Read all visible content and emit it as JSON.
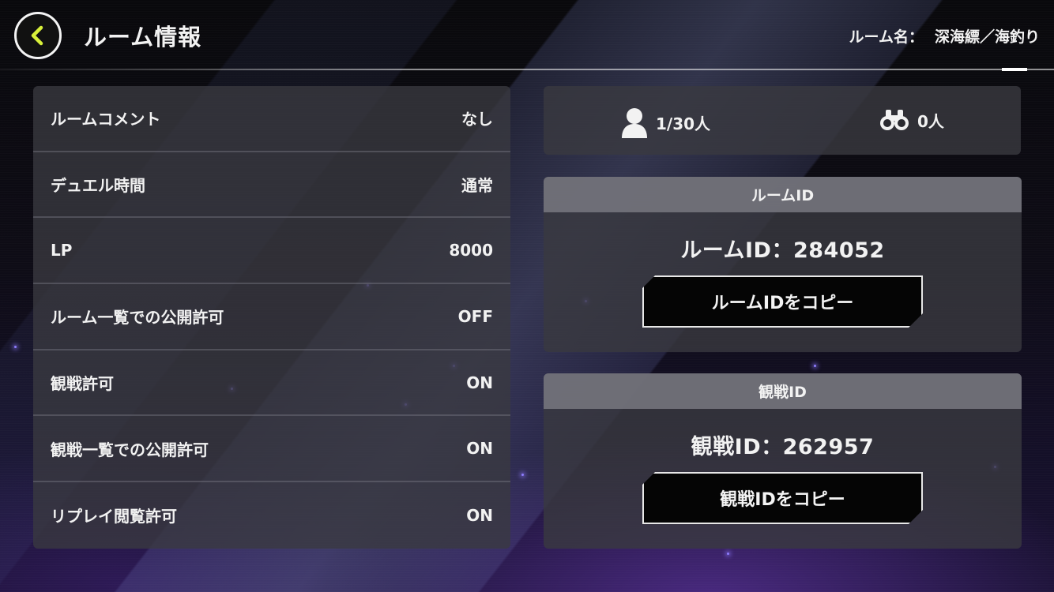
{
  "header": {
    "title": "ルーム情報",
    "room_name_label": "ルーム名：",
    "room_name_value": "深海縹／海釣り"
  },
  "settings": [
    {
      "label": "ルームコメント",
      "value": "なし"
    },
    {
      "label": "デュエル時間",
      "value": "通常"
    },
    {
      "label": "LP",
      "value": "8000"
    },
    {
      "label": "ルーム一覧での公開許可",
      "value": "OFF"
    },
    {
      "label": "観戦許可",
      "value": "ON"
    },
    {
      "label": "観戦一覧での公開許可",
      "value": "ON"
    },
    {
      "label": "リプレイ閲覧許可",
      "value": "ON"
    }
  ],
  "counts": {
    "players": "1/30人",
    "spectators": "0人"
  },
  "room_id_card": {
    "header": "ルームID",
    "id_text": "ルームID：284052",
    "copy_label": "ルームIDをコピー"
  },
  "watch_id_card": {
    "header": "観戦ID",
    "id_text": "観戦ID：262957",
    "copy_label": "観戦IDをコピー"
  },
  "colors": {
    "accent_back_arrow": "#d8f03a",
    "panel_bg": "#3a3a40",
    "card_header_bg": "#78787f"
  },
  "icons": {
    "back": "chevron-left-icon",
    "players": "person-icon",
    "spectators": "binoculars-icon"
  }
}
